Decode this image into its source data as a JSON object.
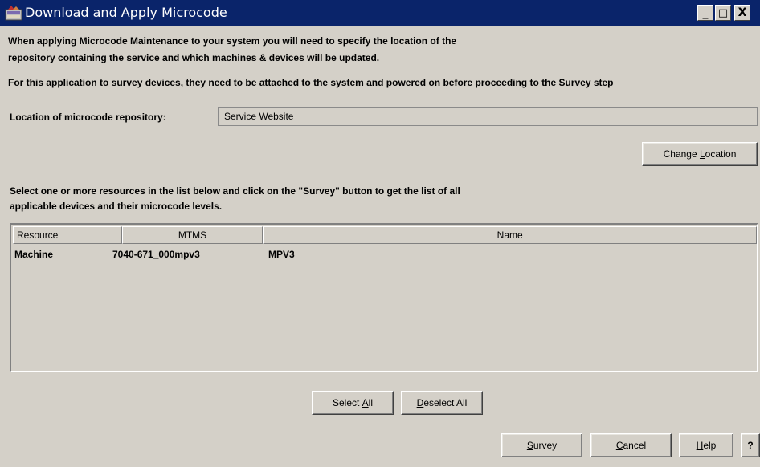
{
  "window": {
    "title": "Download and Apply Microcode",
    "minimize_label": "_",
    "maximize_label": "□",
    "close_label": "X"
  },
  "intro": {
    "line1": "When applying Microcode Maintenance to your system you will need to specify the location of the",
    "line2": "repository containing the service and which machines & devices will be updated.",
    "line3": "For this application to survey devices, they need to be attached to the system and powered on before proceeding to the Survey step"
  },
  "location": {
    "label": "Location of microcode repository:",
    "value": "Service Website"
  },
  "buttons": {
    "change_location_prefix": "Change ",
    "change_location_mnemonic": "L",
    "change_location_suffix": "ocation",
    "select_all_prefix": "Select ",
    "select_all_mnemonic": "A",
    "select_all_suffix": "ll",
    "deselect_all_mnemonic": "D",
    "deselect_all_suffix": "eselect All",
    "survey_mnemonic": "S",
    "survey_suffix": "urvey",
    "cancel_mnemonic": "C",
    "cancel_suffix": "ancel",
    "help_mnemonic": "H",
    "help_suffix": "elp",
    "question_label": "?"
  },
  "instructions": {
    "line1": "Select one or more resources in the list below and click on the \"Survey\" button to get the list of all",
    "line2": "applicable devices and their microcode levels."
  },
  "table": {
    "columns": [
      "Resource",
      "MTMS",
      "Name"
    ],
    "rows": [
      {
        "resource": "Machine",
        "mtms": "7040-671_000mpv3",
        "name": "MPV3"
      }
    ]
  }
}
